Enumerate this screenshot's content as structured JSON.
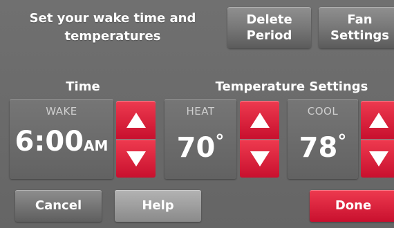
{
  "header": {
    "title_line1": "Set your wake time and",
    "title_line2": "temperatures",
    "delete_line1": "Delete",
    "delete_line2": "Period",
    "fan_line1": "Fan",
    "fan_line2": "Settings"
  },
  "sections": {
    "time_label": "Time",
    "temp_label": "Temperature Settings"
  },
  "wake": {
    "caption": "WAKE",
    "time": "6:00",
    "ampm": "AM"
  },
  "heat": {
    "caption": "HEAT",
    "value": "70",
    "unit": "°"
  },
  "cool": {
    "caption": "COOL",
    "value": "78",
    "unit": "°"
  },
  "footer": {
    "cancel": "Cancel",
    "help": "Help",
    "done": "Done"
  },
  "icons": {
    "up": "up-arrow-icon",
    "down": "down-arrow-icon"
  },
  "colors": {
    "accent": "#d9142f",
    "background": "#6b6b6b"
  }
}
